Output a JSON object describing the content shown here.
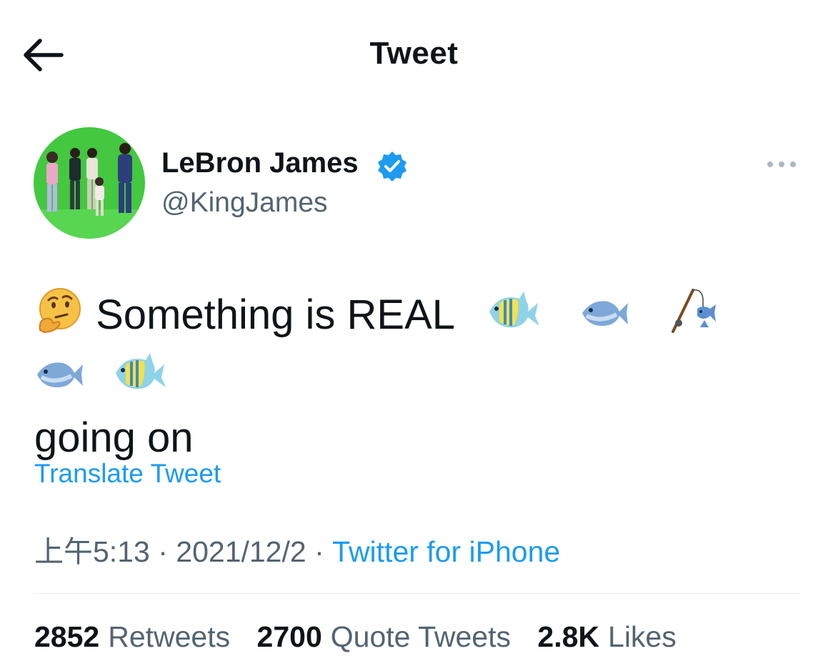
{
  "header": {
    "title": "Tweet",
    "back_icon": "arrow-left-icon"
  },
  "author": {
    "display_name": "LeBron James",
    "handle": "@KingJames",
    "verified": true,
    "avatar_icon": "user-avatar"
  },
  "tweet": {
    "prefix_emoji": "thinking-face",
    "text_line1": "Something is REAL",
    "emojis": [
      "tropical-fish",
      "fish",
      "fishing-pole",
      "fish",
      "tropical-fish"
    ],
    "text_line2": "going on"
  },
  "translate_label": "Translate Tweet",
  "meta": {
    "time": "上午5:13",
    "separator": "·",
    "date": "2021/12/2",
    "source": "Twitter for iPhone"
  },
  "stats": {
    "retweets_count": "2852",
    "retweets_label": "Retweets",
    "quotes_count": "2700",
    "quotes_label": "Quote Tweets",
    "likes_count": "2.8K",
    "likes_label": "Likes"
  },
  "colors": {
    "link": "#1d9bf0",
    "secondary_text": "#536471",
    "primary_text": "#0f1419",
    "avatar_bg": "#43c840"
  }
}
